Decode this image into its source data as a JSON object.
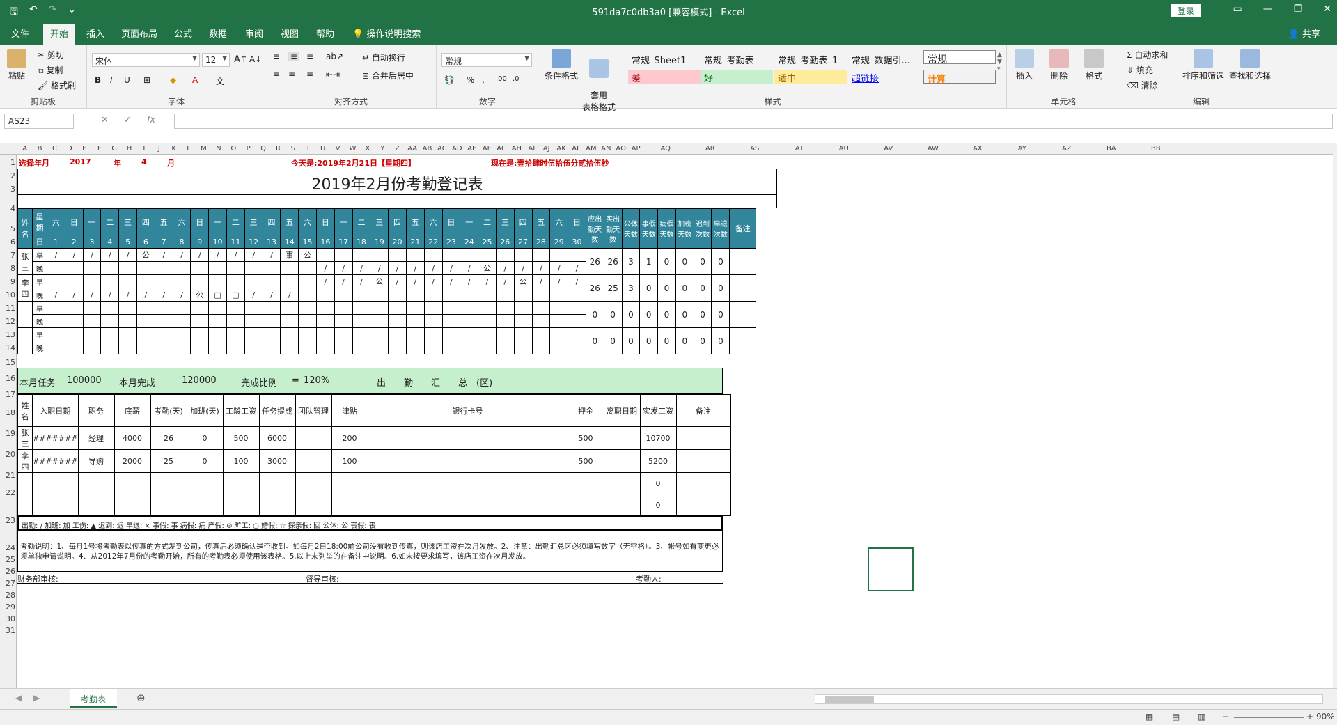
{
  "title_bar": {
    "document_title": "591da7c0db3a0 [兼容模式] - Excel",
    "login_label": "登录"
  },
  "tabs": [
    "文件",
    "开始",
    "插入",
    "页面布局",
    "公式",
    "数据",
    "审阅",
    "视图",
    "帮助",
    "操作说明搜索"
  ],
  "share_label": "共享",
  "ribbon": {
    "clipboard": {
      "paste": "粘贴",
      "cut": "剪切",
      "copy": "复制",
      "format_painter": "格式刷",
      "label": "剪贴板"
    },
    "font": {
      "name": "宋体",
      "size": "12",
      "label": "字体"
    },
    "alignment": {
      "wrap": "自动换行",
      "merge": "合并后居中",
      "label": "对齐方式"
    },
    "number": {
      "format": "常规",
      "label": "数字"
    },
    "styles": {
      "cond_format": "条件格式",
      "table_format": "套用\n表格格式",
      "cells": [
        "常规_Sheet1",
        "常规_考勤表",
        "常规_考勤表_1",
        "常规_数据引...",
        "常规",
        "差",
        "好",
        "适中",
        "超链接",
        "计算"
      ],
      "label": "样式"
    },
    "cells": {
      "insert": "插入",
      "delete": "删除",
      "format": "格式",
      "label": "单元格"
    },
    "editing": {
      "autosum": "自动求和",
      "fill": "填充",
      "clear": "清除",
      "sort": "排序和筛选",
      "find": "查找和选择",
      "label": "编辑"
    }
  },
  "formula_bar": {
    "name_box": "AS23",
    "formula": ""
  },
  "colors": {
    "brand": "#217346",
    "header_blue": "#31869b",
    "summary_green": "#c6efce"
  },
  "columns": [
    "A",
    "B",
    "C",
    "D",
    "E",
    "F",
    "G",
    "H",
    "I",
    "J",
    "K",
    "L",
    "M",
    "N",
    "O",
    "P",
    "Q",
    "R",
    "S",
    "T",
    "U",
    "V",
    "W",
    "X",
    "Y",
    "Z",
    "AA",
    "AB",
    "AC",
    "AD",
    "AE",
    "AF",
    "AG",
    "AH",
    "AI",
    "AJ",
    "AK",
    "AL",
    "AM",
    "AN",
    "AO",
    "AP",
    "AQ",
    "AR",
    "AS",
    "AT",
    "AU",
    "AV",
    "AW",
    "AX",
    "AY",
    "AZ",
    "BA",
    "BB"
  ],
  "rows": [
    "1",
    "2",
    "3",
    "4",
    "5",
    "6",
    "7",
    "8",
    "9",
    "10",
    "11",
    "12",
    "13",
    "14",
    "15",
    "16",
    "17",
    "18",
    "19",
    "20",
    "21",
    "22",
    "23",
    "24",
    "25",
    "26",
    "27",
    "28",
    "29",
    "30",
    "31"
  ],
  "sheet": {
    "row1": {
      "select_label": "选择年月",
      "year": "2017",
      "year_unit": "年",
      "month": "4",
      "month_unit": "月",
      "today": "今天是:2019年2月21日【星期四】",
      "now": "现在是:壹拾肆时伍拾伍分贰拾伍秒"
    },
    "title": "2019年2月份考勤登记表",
    "hdr_name": "姓名",
    "hdr_week": "星期",
    "hdr_day": "日",
    "weekdays": [
      "六",
      "日",
      "一",
      "二",
      "三",
      "四",
      "五",
      "六",
      "日",
      "一",
      "二",
      "三",
      "四",
      "五",
      "六",
      "日",
      "一",
      "二",
      "三",
      "四",
      "五",
      "六",
      "日",
      "一",
      "二",
      "三",
      "四",
      "五",
      "六",
      "日"
    ],
    "days": [
      "1",
      "2",
      "3",
      "4",
      "5",
      "6",
      "7",
      "8",
      "9",
      "10",
      "11",
      "12",
      "13",
      "14",
      "15",
      "16",
      "17",
      "18",
      "19",
      "20",
      "21",
      "22",
      "23",
      "24",
      "25",
      "26",
      "27",
      "28",
      "29",
      "30"
    ],
    "stat_headers": [
      "应出勤天数",
      "实出勤天数",
      "公休天数",
      "事假天数",
      "病假天数",
      "加班天数",
      "迟到次数",
      "早退次数"
    ],
    "remark_hdr": "备注",
    "employees": [
      {
        "name": "张三",
        "am": [
          "/",
          "/",
          "/",
          "/",
          "/",
          "公",
          "/",
          "/",
          "/",
          "/",
          "/",
          "/",
          "/",
          "事",
          "公",
          "",
          "",
          "",
          "",
          "",
          "",
          "",
          "",
          "",
          "",
          "",
          "",
          "",
          "",
          ""
        ],
        "pm": [
          "",
          "",
          "",
          "",
          "",
          "",
          "",
          "",
          "",
          "",
          "",
          "",
          "",
          "",
          "",
          "/",
          "/",
          "/",
          "/",
          "/",
          "/",
          "/",
          "/",
          "/",
          "公",
          "/",
          "/",
          "/",
          "/",
          "/"
        ],
        "stats": [
          "26",
          "26",
          "3",
          "1",
          "0",
          "0",
          "0",
          "0"
        ]
      },
      {
        "name": "李四",
        "am": [
          "",
          "",
          "",
          "",
          "",
          "",
          "",
          "",
          "",
          "",
          "",
          "",
          "",
          "",
          "",
          "/",
          "/",
          "/",
          "公",
          "/",
          "/",
          "/",
          "/",
          "/",
          "/",
          "/",
          "公",
          "/",
          "/",
          "/"
        ],
        "pm": [
          "/",
          "/",
          "/",
          "/",
          "/",
          "/",
          "/",
          "/",
          "公",
          "□",
          "□",
          "/",
          "/",
          "/",
          "",
          "",
          "",
          "",
          "",
          "",
          "",
          "",
          "",
          "",
          "",
          "",
          "",
          "",
          "",
          ""
        ],
        "stats": [
          "26",
          "25",
          "3",
          "0",
          "0",
          "0",
          "0",
          "0"
        ]
      },
      {
        "name": "",
        "am": [],
        "pm": [],
        "stats": [
          "0",
          "0",
          "0",
          "0",
          "0",
          "0",
          "0",
          "0"
        ]
      },
      {
        "name": "",
        "am": [],
        "pm": [],
        "stats": [
          "0",
          "0",
          "0",
          "0",
          "0",
          "0",
          "0",
          "0"
        ]
      }
    ],
    "am_label": "早",
    "pm_label": "晚",
    "summary_bar": {
      "task_label": "本月任务",
      "task": "100000",
      "done_label": "本月完成",
      "done": "120000",
      "ratio_label": "完成比例",
      "eq": "=",
      "ratio": "120%",
      "section": "出　　勤　　汇　　总　(区)"
    },
    "pay_headers": [
      "姓名",
      "入职日期",
      "职务",
      "底薪",
      "考勤(天)",
      "加班(天)",
      "工龄工资",
      "任务提成",
      "团队管理",
      "津贴",
      "银行卡号",
      "押金",
      "离职日期",
      "实发工资",
      "备注"
    ],
    "pay_rows": [
      [
        "张三",
        "#######",
        "经理",
        "4000",
        "26",
        "0",
        "500",
        "6000",
        "",
        "200",
        "",
        "500",
        "",
        "10700",
        ""
      ],
      [
        "李四",
        "#######",
        "导购",
        "2000",
        "25",
        "0",
        "100",
        "3000",
        "",
        "100",
        "",
        "500",
        "",
        "5200",
        ""
      ],
      [
        "",
        "",
        "",
        "",
        "",
        "",
        "",
        "",
        "",
        "",
        "",
        "",
        "",
        "0",
        ""
      ],
      [
        "",
        "",
        "",
        "",
        "",
        "",
        "",
        "",
        "",
        "",
        "",
        "",
        "",
        "0",
        ""
      ]
    ],
    "legend": "出勤: /   加班: 加   工伤: ▲   迟到: 迟   早退: ×   事假: 事   病假: 病   产假: ⊙   旷工: ○   婚假: ☆   探亲假: 回   公休: 公   丧假: 丧",
    "note": "考勤说明：1、每月1号将考勤表以传真的方式发到公司，传真后必须确认是否收到。如每月2日18:00前公司没有收到传真，则该店工资在次月发放。2、注意：出勤汇总区必须填写数字（无空格）。3、帐号如有变更必须单独申请说明。4、从2012年7月份的考勤开始，所有的考勤表必须使用该表格。5.以上未列举的在备注中说明。6.如未按要求填写，该店工资在次月发放。",
    "sign": {
      "finance": "财务部审核:",
      "supervisor": "督导审核:",
      "recorder": "考勤人:"
    }
  },
  "sheet_tab": "考勤表",
  "zoom": "90%"
}
